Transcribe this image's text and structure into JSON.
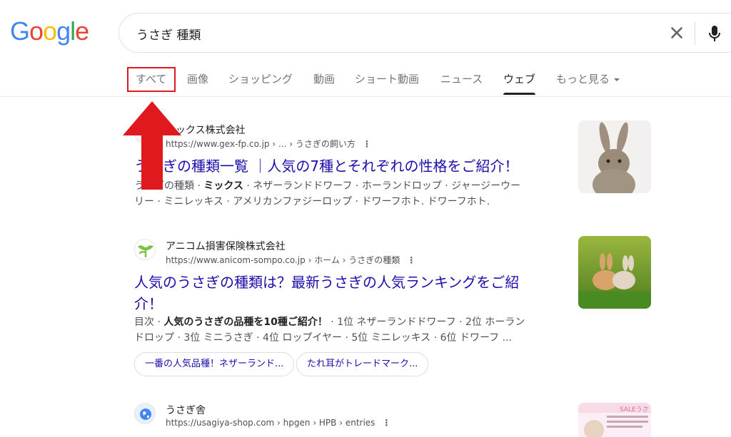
{
  "logo": {
    "g1": "G",
    "o1": "o",
    "o2": "o",
    "g2": "g",
    "l": "l",
    "e": "e"
  },
  "search": {
    "query": "うさぎ 種類"
  },
  "tabs": [
    {
      "label": "すべて"
    },
    {
      "label": "画像"
    },
    {
      "label": "ショッピング"
    },
    {
      "label": "動画"
    },
    {
      "label": "ショート動画"
    },
    {
      "label": "ニュース"
    },
    {
      "label": "ウェブ"
    },
    {
      "label": "もっと見る"
    }
  ],
  "results": [
    {
      "site": "ニックス株式会社",
      "url": "https://www.gex-fp.co.jp › ... › うさぎの飼い方",
      "title": "うさぎの種類一覧 ｜人気の7種とそれぞれの性格をご紹介！",
      "snippet_1a": "うさぎの種類 · ",
      "snippet_1b": "ミックス",
      "snippet_1c": " · ネザーランドドワーフ · ホーランドロップ · ジャージーウー",
      "snippet_2": "リー · ミニレッキス · アメリカンファジーロップ · ドワーフホト. ドワーフホト."
    },
    {
      "site": "アニコム損害保険株式会社",
      "url": "https://www.anicom-sompo.co.jp › ホーム › うさぎの種類",
      "title_1": "人気のうさぎの種類は？最新うさぎの人気ランキングをご紹",
      "title_2": "介！",
      "snippet_1a": "目次 · ",
      "snippet_1b": "人気のうさぎの品種を10種ご紹介！",
      "snippet_1c": " · 1位 ネザーランドドワーフ · 2位 ホーラン",
      "snippet_2": "ドロップ · 3位 ミニうさぎ · 4位 ロップイヤー · 5位 ミニレッキス · 6位 ドワーフ ...",
      "chips": [
        "一番の人気品種！ネザーランド...",
        "たれ耳がトレードマーク..."
      ]
    },
    {
      "site": "うさぎ舎",
      "url": "https://usagiya-shop.com › hpgen › HPB › entries",
      "thumb_text": "SALEうさ"
    }
  ],
  "colors": {
    "link": "#1a0dab",
    "highlight_box": "#e0191f",
    "arrow": "#e0191f"
  },
  "icons": [
    "close-icon",
    "mic-icon",
    "more-vert-icon",
    "up-arrow-icon"
  ]
}
